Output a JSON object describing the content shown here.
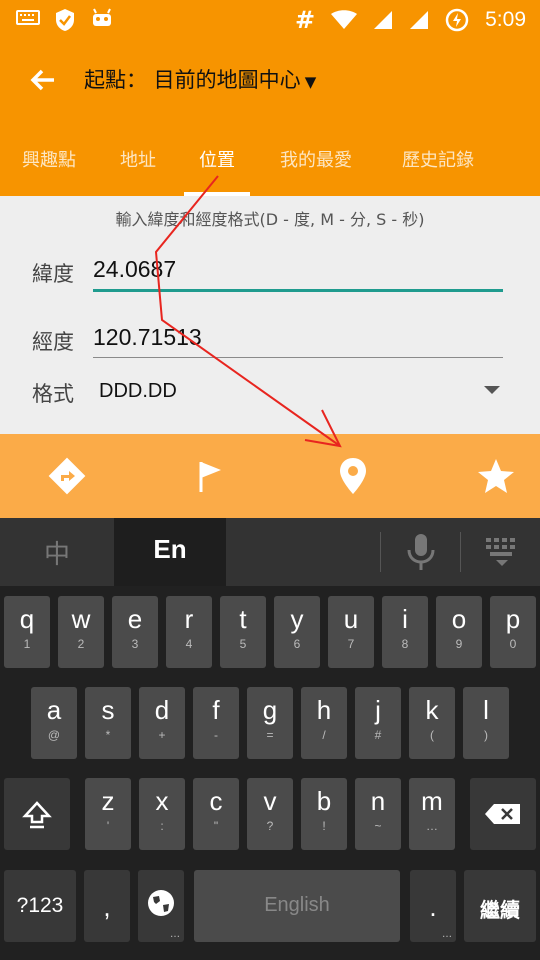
{
  "status_bar": {
    "time": "5:09",
    "hash_symbol": "#",
    "icons": [
      "keyboard-icon",
      "shield-icon",
      "android-icon",
      "wifi-icon",
      "signal-icon",
      "signal-icon",
      "battery-charging-icon"
    ]
  },
  "app_bar": {
    "title": "起點： 目前的地圖中心"
  },
  "tabs": [
    {
      "label": "興趣點",
      "active": false
    },
    {
      "label": "地址",
      "active": false
    },
    {
      "label": "位置",
      "active": true
    },
    {
      "label": "我的最愛",
      "active": false
    },
    {
      "label": "歷史記錄",
      "active": false
    }
  ],
  "form": {
    "hint": "輸入緯度和經度格式(D - 度, M - 分, S - 秒)",
    "latitude_label": "緯度",
    "latitude_value": "24.0687",
    "longitude_label": "經度",
    "longitude_value": "120.71513",
    "format_label": "格式",
    "format_value": "DDD.DD"
  },
  "bottom_tabs": [
    "directions-icon",
    "flag-icon",
    "location-pin-icon",
    "star-icon"
  ],
  "colors": {
    "primary": "#f79400",
    "secondary": "#fbab48",
    "accent": "#1f9b8e",
    "annotation": "#e8251f"
  },
  "keyboard": {
    "lang_zh": "中",
    "lang_en": "En",
    "row1": [
      {
        "k": "q",
        "s": "1"
      },
      {
        "k": "w",
        "s": "2"
      },
      {
        "k": "e",
        "s": "3"
      },
      {
        "k": "r",
        "s": "4"
      },
      {
        "k": "t",
        "s": "5"
      },
      {
        "k": "y",
        "s": "6"
      },
      {
        "k": "u",
        "s": "7"
      },
      {
        "k": "i",
        "s": "8"
      },
      {
        "k": "o",
        "s": "9"
      },
      {
        "k": "p",
        "s": "0"
      }
    ],
    "row2": [
      {
        "k": "a",
        "s": "@"
      },
      {
        "k": "s",
        "s": "*"
      },
      {
        "k": "d",
        "s": "+"
      },
      {
        "k": "f",
        "s": "-"
      },
      {
        "k": "g",
        "s": "="
      },
      {
        "k": "h",
        "s": "/"
      },
      {
        "k": "j",
        "s": "#"
      },
      {
        "k": "k",
        "s": "("
      },
      {
        "k": "l",
        "s": ")"
      }
    ],
    "row3": [
      {
        "k": "z",
        "s": "'"
      },
      {
        "k": "x",
        "s": ":"
      },
      {
        "k": "c",
        "s": "\""
      },
      {
        "k": "v",
        "s": "?"
      },
      {
        "k": "b",
        "s": "!"
      },
      {
        "k": "n",
        "s": "~"
      },
      {
        "k": "m",
        "s": "…"
      }
    ],
    "num_key": "?123",
    "comma_key": ",",
    "space_label": "English",
    "period_key": ".",
    "enter_label": "繼續"
  }
}
